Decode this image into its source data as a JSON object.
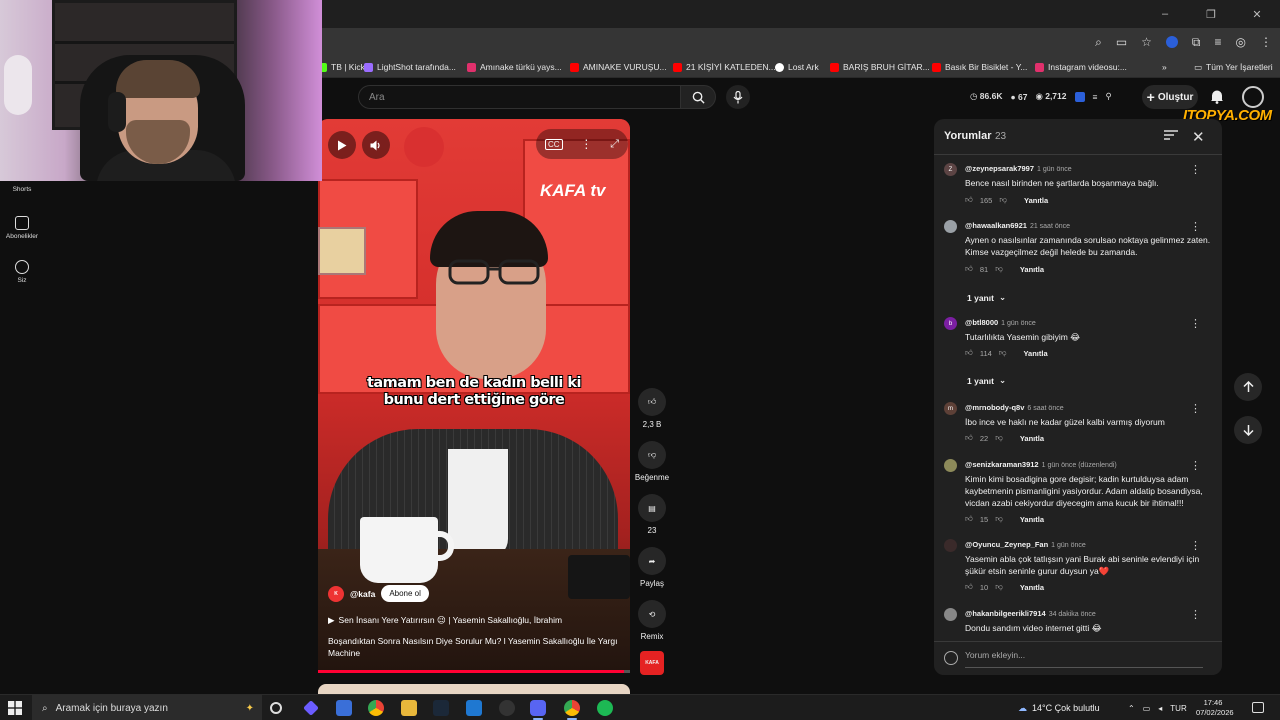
{
  "browser": {
    "window_controls": [
      "–",
      "❐",
      "✕"
    ],
    "bookmarks": [
      {
        "label": "TB | Kick",
        "color": "#53fc18"
      },
      {
        "label": "LightShot tarafında...",
        "color": "#9b6dff"
      },
      {
        "label": "Amınake türkü yays...",
        "color": "#e1306c"
      },
      {
        "label": "AMINAKE VURUŞU...",
        "color": "#ff0000"
      },
      {
        "label": "21 KİŞİYİ KATLEDEN...",
        "color": "#ff0000"
      },
      {
        "label": "Lost Ark",
        "color": "#ffffff"
      },
      {
        "label": "BARIŞ BRUH GİTAR...",
        "color": "#ff0000"
      },
      {
        "label": "Basık Bir Bisiklet - Y...",
        "color": "#ff0000"
      },
      {
        "label": "Instagram videosu:...",
        "color": "#e1306c"
      }
    ],
    "bookmarks_more": "»",
    "all_bookmarks": "Tüm Yer İşaretleri"
  },
  "header": {
    "search_placeholder": "Ara",
    "stats": [
      "86.6K",
      "67",
      "2,712"
    ],
    "create_label": "Oluştur",
    "watermark": "ITOPYA.COM"
  },
  "sidebar": {
    "items": [
      {
        "label": "Shorts"
      },
      {
        "label": "Abonelikler"
      },
      {
        "label": "Siz"
      }
    ]
  },
  "video": {
    "brand_logo": "KAFA tv",
    "subtitle_line1": "tamam ben de kadın belli ki",
    "subtitle_line2": "bunu dert ettiğine göre",
    "channel": "@kafa",
    "subscribe_label": "Abone ol",
    "playlist_label": "Sen İnsanı Yere Yatırırsın 😉 | Yasemin Sakallıoğlu, İbrahim",
    "title": "Boşandıktan Sonra Nasılsın Diye Sorulur Mu? l Yasemin Sakallıoğlu İle Yargı Machine",
    "progress_fraction": 0.98
  },
  "actions": {
    "like_count": "2,3 B",
    "dislike_label": "Beğenme",
    "comment_count": "23",
    "share_label": "Paylaş",
    "remix_label": "Remix"
  },
  "comments": {
    "title": "Yorumlar",
    "count": "23",
    "input_placeholder": "Yorum ekleyin...",
    "reply_label": "Yanıtla",
    "items": [
      {
        "user": "@zeynepsarak7997",
        "time": "1 gün önce",
        "text": "Bence nasıl birinden ne şartlarda boşanmaya bağlı.",
        "likes": "165",
        "avatar_letter": "Z",
        "avatar_color": "#5c4444"
      },
      {
        "user": "@hawaalkan6921",
        "time": "21 saat önce",
        "text": "Aynen o nasılsınlar zamanında sorulsao noktaya gelinmez zaten. Kimse vazgeçilmez değil helede bu zamanda.",
        "likes": "81",
        "avatar_letter": "",
        "avatar_color": "#9aa0a6",
        "replies": "1 yanıt"
      },
      {
        "user": "@btl8000",
        "time": "1 gün önce",
        "text": "Tutarlılıkta Yasemin gibiyim 😂",
        "likes": "114",
        "avatar_letter": "b",
        "avatar_color": "#7b1fa2",
        "replies": "1 yanıt"
      },
      {
        "user": "@mrnobody-q8v",
        "time": "6 saat önce",
        "text": "İbo ince ve haklı  ne kadar güzel kalbi varmış diyorum",
        "likes": "22",
        "avatar_letter": "m",
        "avatar_color": "#5d4037"
      },
      {
        "user": "@senizkaraman3912",
        "time": "1 gün önce (düzenlendi)",
        "text": "Kimin kimi bosadigina gore degisir; kadin kurtulduysa adam kaybetmenin pismanligini yasiyordur. Adam aldatip bosandiysa, vicdan azabi cekiyordur diyecegim ama kucuk bir ihtimal!!!",
        "likes": "15",
        "avatar_letter": "",
        "avatar_color": "#8d8a5a"
      },
      {
        "user": "@Oyuncu_Zeynep_Fan",
        "time": "1 gün önce",
        "text": "Yasemin abla çok tatlışsın yani Burak abi seninle evlendiyi için şükür etsin seninle gurur duysun ya❤️",
        "likes": "10",
        "avatar_letter": "",
        "avatar_color": "#3a2a2a"
      },
      {
        "user": "@hakanbilgeerikli7914",
        "time": "34 dakika önce",
        "text": "Dondu sandım video internet gitti 😂",
        "likes": "",
        "avatar_letter": "",
        "avatar_color": "#888888"
      }
    ]
  },
  "taskbar": {
    "search_placeholder": "Aramak için buraya yazın",
    "weather": "14°C  Çok bulutlu",
    "lang": "TUR",
    "time": "17:46",
    "date": "07/02/2026"
  },
  "colors": {
    "background": "#0f0f0f",
    "panel": "#212121",
    "accent_red": "#ff0033"
  }
}
